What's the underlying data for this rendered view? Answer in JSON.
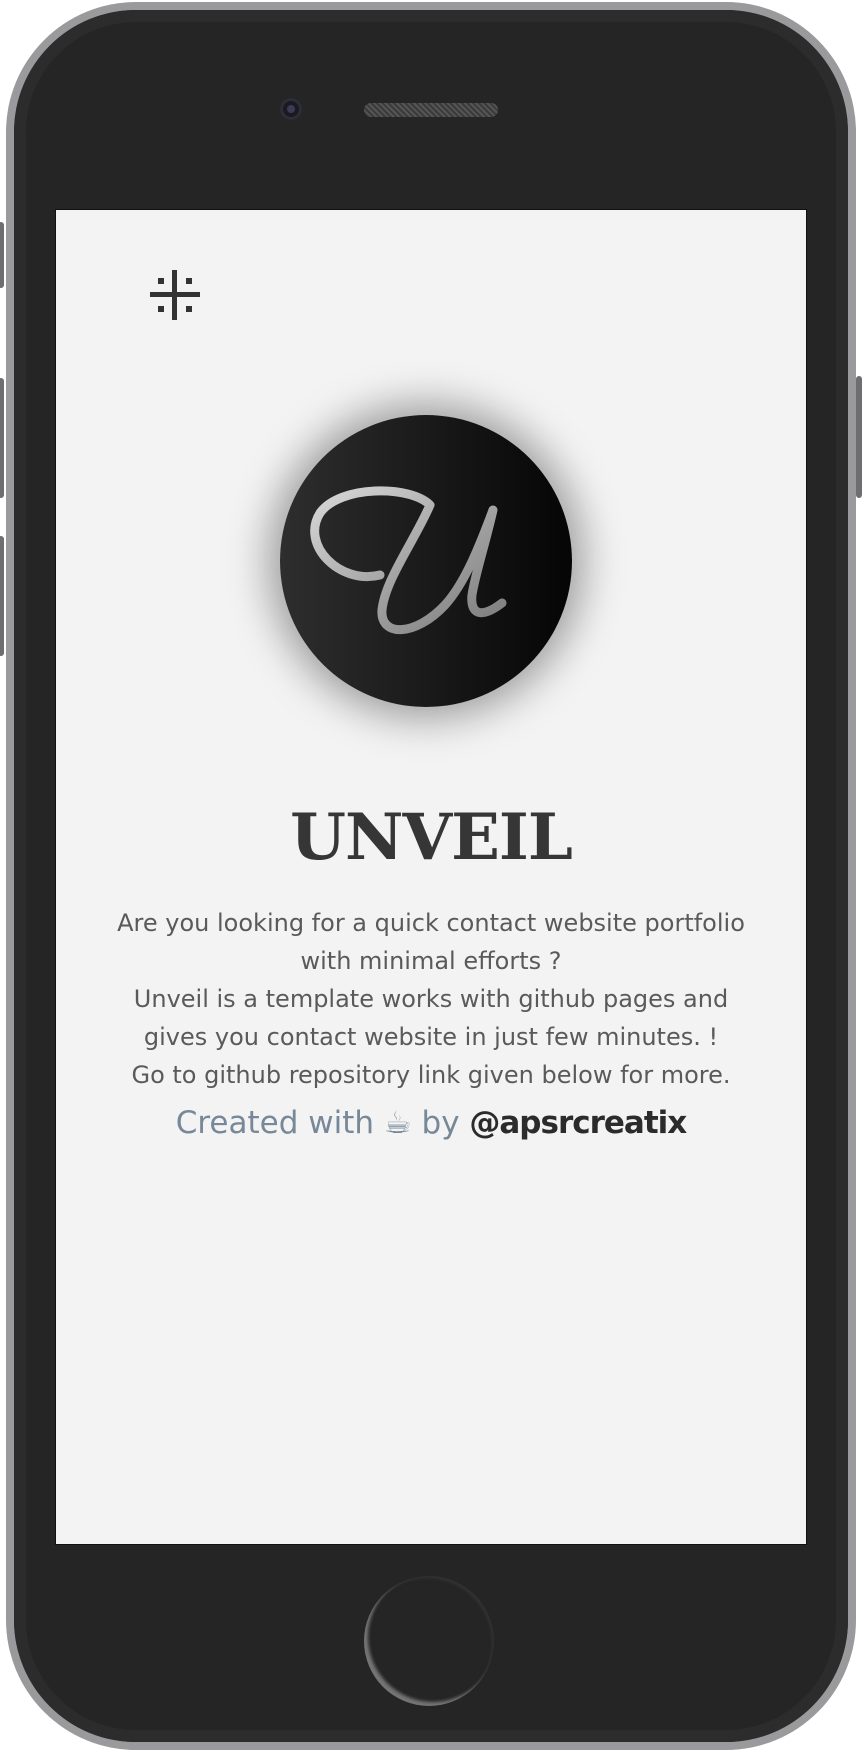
{
  "app": {
    "title": "UNVEIL",
    "description_lines": [
      "Are you looking for a quick contact website portfolio",
      "with minimal efforts ?",
      "Unveil is a template works with github pages and",
      "gives you contact website in just few minutes. !",
      "Go to github repository link given below for more."
    ],
    "credit_prefix": "Created with ",
    "credit_emoji": "☕",
    "credit_by": " by ",
    "credit_handle": "@apsrcreatix",
    "logo_letter": "U"
  },
  "icons": {
    "menu": "hash-grid-icon",
    "logo": "script-u-logo"
  },
  "colors": {
    "screen_bg": "#f3f3f3",
    "title": "#363636",
    "body_text": "#5a5a5a",
    "credit_text": "#778899",
    "handle_text": "#2b2b2b",
    "phone_body": "#252525",
    "phone_frame": "#9a9a9c"
  }
}
